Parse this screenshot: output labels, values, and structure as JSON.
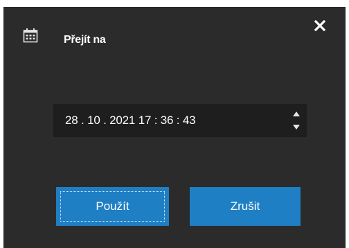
{
  "dialog": {
    "title": "Přejít na",
    "title_icon": "calendar-icon",
    "close_icon": "close-icon"
  },
  "datetime": {
    "value": "28 . 10 . 2021 17 : 36 : 43",
    "spin_up_icon": "triangle-up-icon",
    "spin_down_icon": "triangle-down-icon"
  },
  "buttons": {
    "apply_label": "Použít",
    "cancel_label": "Zrušit"
  },
  "colors": {
    "background": "#2b2b2b",
    "field_background": "#1e1e1e",
    "button_accent": "#1e7fc4",
    "text": "#ffffff"
  }
}
